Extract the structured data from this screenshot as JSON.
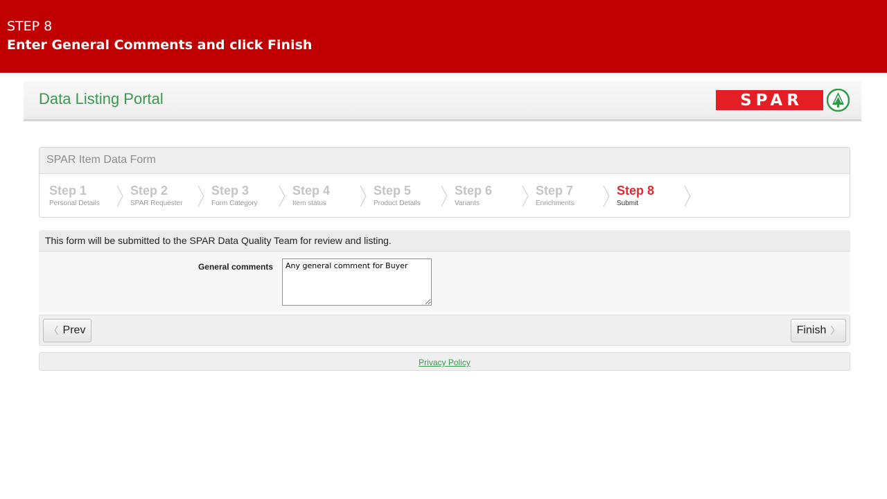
{
  "banner": {
    "step": "STEP 8",
    "instruction": "Enter General Comments and click Finish"
  },
  "portal": {
    "title": "Data Listing Portal",
    "logo_text": "SPAR"
  },
  "wizard": {
    "title": "SPAR Item Data Form",
    "steps": [
      {
        "label": "Step 1",
        "sub": "Personal Details"
      },
      {
        "label": "Step 2",
        "sub": "SPAR Requester"
      },
      {
        "label": "Step 3",
        "sub": "Form Category"
      },
      {
        "label": "Step 4",
        "sub": "Item status"
      },
      {
        "label": "Step 5",
        "sub": "Product Details"
      },
      {
        "label": "Step 6",
        "sub": "Variants"
      },
      {
        "label": "Step 7",
        "sub": "Enrichments"
      },
      {
        "label": "Step 8",
        "sub": "Submit"
      }
    ],
    "active_step": 8
  },
  "form": {
    "info_text": "This form will be submitted to the SPAR Data Quality Team for review and listing.",
    "general_comments_label": "General comments",
    "general_comments_value": "Any general comment for Buyer"
  },
  "buttons": {
    "prev": "Prev",
    "finish": "Finish"
  },
  "footer": {
    "privacy_link": "Privacy Policy"
  },
  "colors": {
    "banner": "#c00000",
    "brand_green": "#3a9a4c",
    "spar_red": "#e31e24",
    "active_step": "#e8262b"
  }
}
